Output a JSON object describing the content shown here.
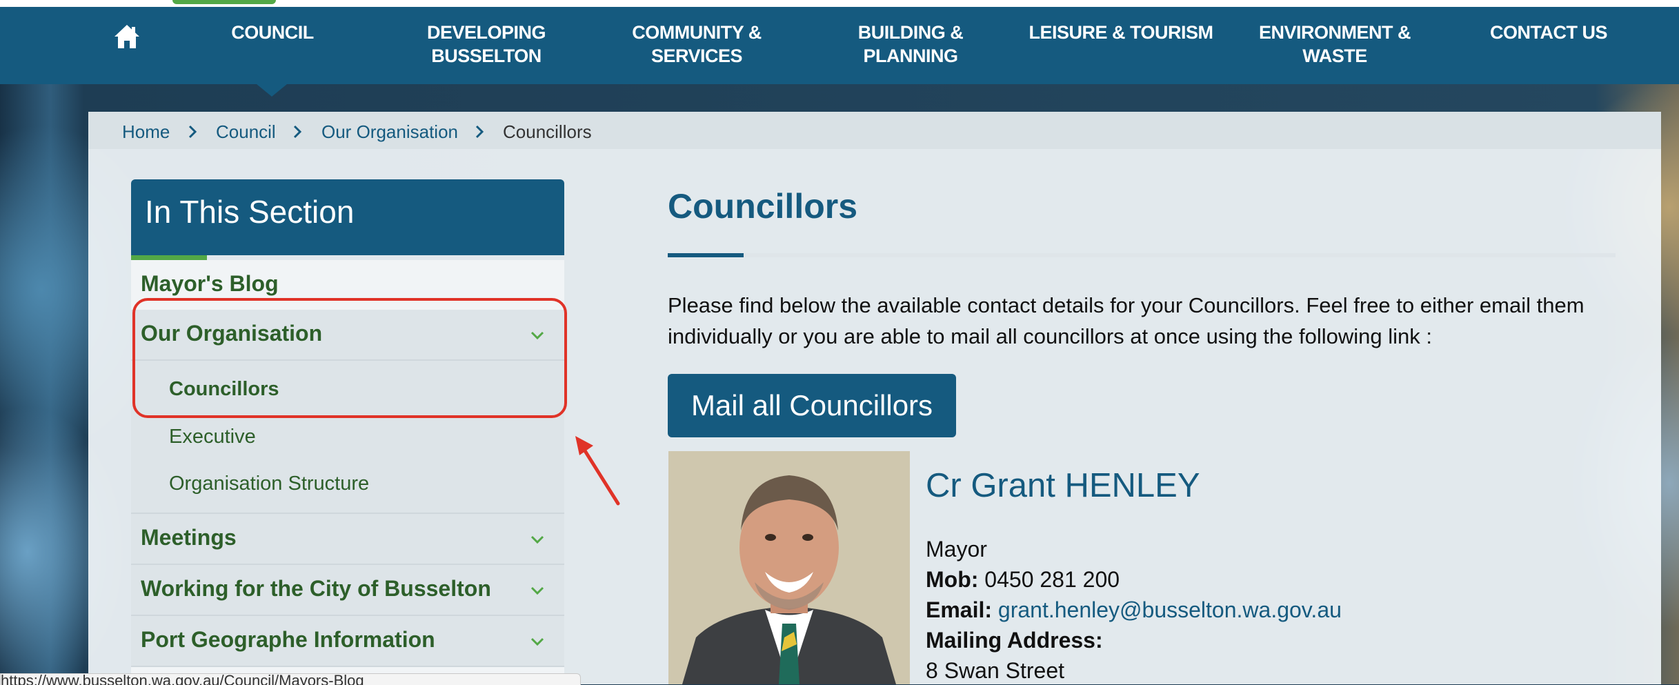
{
  "nav": {
    "items": [
      {
        "line1": "COUNCIL",
        "line2": ""
      },
      {
        "line1": "DEVELOPING",
        "line2": "BUSSELTON"
      },
      {
        "line1": "COMMUNITY &",
        "line2": "SERVICES"
      },
      {
        "line1": "BUILDING &",
        "line2": "PLANNING"
      },
      {
        "line1": "LEISURE & TOURISM",
        "line2": ""
      },
      {
        "line1": "ENVIRONMENT &",
        "line2": "WASTE"
      },
      {
        "line1": "CONTACT US",
        "line2": ""
      }
    ],
    "home_icon": "home-icon"
  },
  "breadcrumb": [
    "Home",
    "Council",
    "Our Organisation",
    "Councillors"
  ],
  "sidebar": {
    "title": "In This Section",
    "items": [
      {
        "label": "Mayor's Blog"
      },
      {
        "label": "Our Organisation",
        "expanded": true
      },
      {
        "label": "Meetings"
      },
      {
        "label": "Working for the City of Busselton"
      },
      {
        "label": "Port Geographe Information"
      }
    ],
    "subitems": [
      "Councillors",
      "Executive",
      "Organisation Structure"
    ]
  },
  "main": {
    "title": "Councillors",
    "intro": "Please find below the available contact details for your Councillors. Feel free to either email them individually or you are able to mail all councillors at once using the following link :",
    "mail_button": "Mail all Councillors",
    "councillor": {
      "name": "Cr Grant HENLEY",
      "role": "Mayor",
      "mob_label": "Mob:",
      "mob": "0450 281 200",
      "email_label": "Email:",
      "email": "grant.henley@busselton.wa.gov.au",
      "address_label": "Mailing Address:",
      "address": "8 Swan Street"
    }
  },
  "status_url": "https://www.busselton.wa.gov.au/Council/Mayors-Blog",
  "colors": {
    "brand": "#155a7f",
    "accent_green": "#53a846",
    "highlight": "#e03328"
  }
}
